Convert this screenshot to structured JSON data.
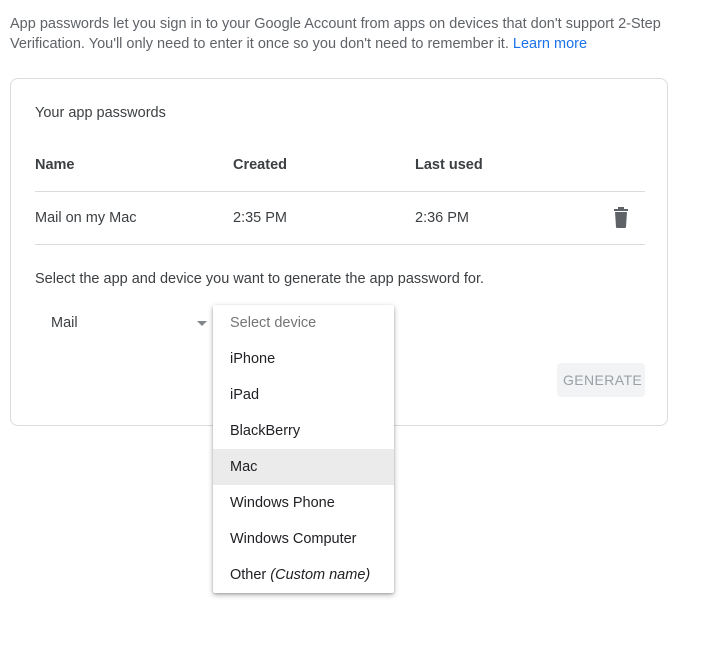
{
  "intro": {
    "text": "App passwords let you sign in to your Google Account from apps on devices that don't support 2-Step Verification. You'll only need to enter it once so you don't need to remember it.",
    "link": "Learn more"
  },
  "card": {
    "title": "Your app passwords",
    "columns": {
      "name": "Name",
      "created": "Created",
      "last_used": "Last used"
    },
    "rows": [
      {
        "name": "Mail on my Mac",
        "created": "2:35 PM",
        "last_used": "2:36 PM"
      }
    ],
    "instruction": "Select the app and device you want to generate the app password for.",
    "app_select": {
      "value": "Mail"
    },
    "generate_label": "GENERATE"
  },
  "device_dropdown": {
    "placeholder": "Select device",
    "options": [
      "iPhone",
      "iPad",
      "BlackBerry",
      "Mac",
      "Windows Phone",
      "Windows Computer"
    ],
    "other_label": "Other",
    "other_hint": "(Custom name)",
    "highlighted": "Mac"
  },
  "colors": {
    "link": "#1a73e8",
    "divider": "#dadce0",
    "highlight": "#ebebeb",
    "generate_bg": "#f1f3f4",
    "generate_text": "#9aa0a6"
  },
  "icons": {
    "delete": "trash-icon",
    "app_select_caret": "caret-down-icon"
  }
}
